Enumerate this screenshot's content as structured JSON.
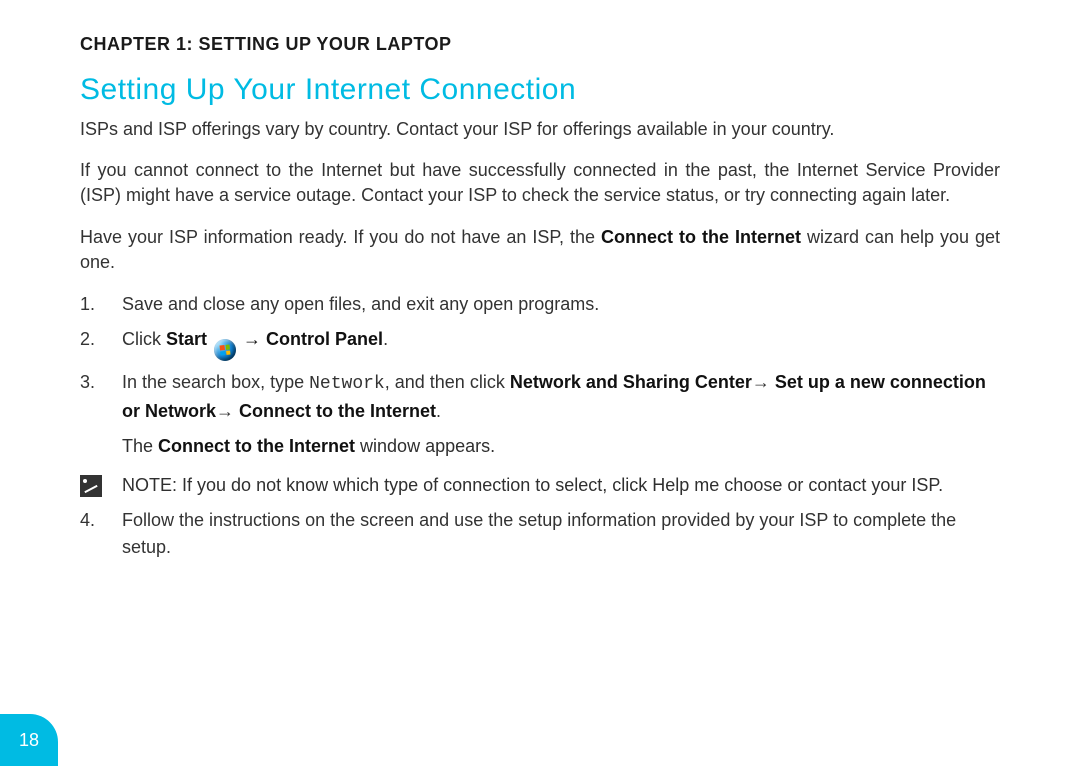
{
  "chapter_label": "CHAPTER 1:  SETTING UP YOUR LAPTOP",
  "section_heading": "Setting Up Your Internet Connection",
  "para1": "ISPs and ISP offerings vary by country. Contact your ISP for offerings available in your country.",
  "para2": "If you cannot connect to the Internet but have successfully connected in the past, the Internet Service Provider (ISP) might have a service outage. Contact your ISP to check the service status, or try connecting again later.",
  "para3_pre": "Have your ISP information ready. If you do not have an ISP, the ",
  "para3_bold": "Connect to the Internet",
  "para3_post": " wizard can help you get one.",
  "steps": {
    "s1": {
      "num": "1.",
      "text": "Save and close any open files, and exit any open programs."
    },
    "s2": {
      "num": "2.",
      "pre": "Click ",
      "bold_start": "Start",
      "arrow": " → ",
      "bold_cp": "Control Panel",
      "period": "."
    },
    "s3": {
      "num": "3.",
      "pre": "In the search box, type ",
      "mono": "Network",
      "post_comma": ", and then click ",
      "b1": "Network and Sharing Center",
      "a1": "→ ",
      "b2": "Set up a new connection or Network",
      "a2": "→ ",
      "b3": "Connect to the Internet",
      "end": "."
    },
    "s3_sub_pre": "The ",
    "s3_sub_bold": "Connect to the Internet",
    "s3_sub_post": " window appears.",
    "note": {
      "label": "NOTE:",
      "pre": " If you do not know which type of connection to select, click ",
      "b": "Help me choose",
      "post": " or contact your ISP."
    },
    "s4": {
      "num": "4.",
      "text": "Follow the instructions on the screen and use the setup information provided by your ISP to complete the setup."
    }
  },
  "page_number": "18"
}
